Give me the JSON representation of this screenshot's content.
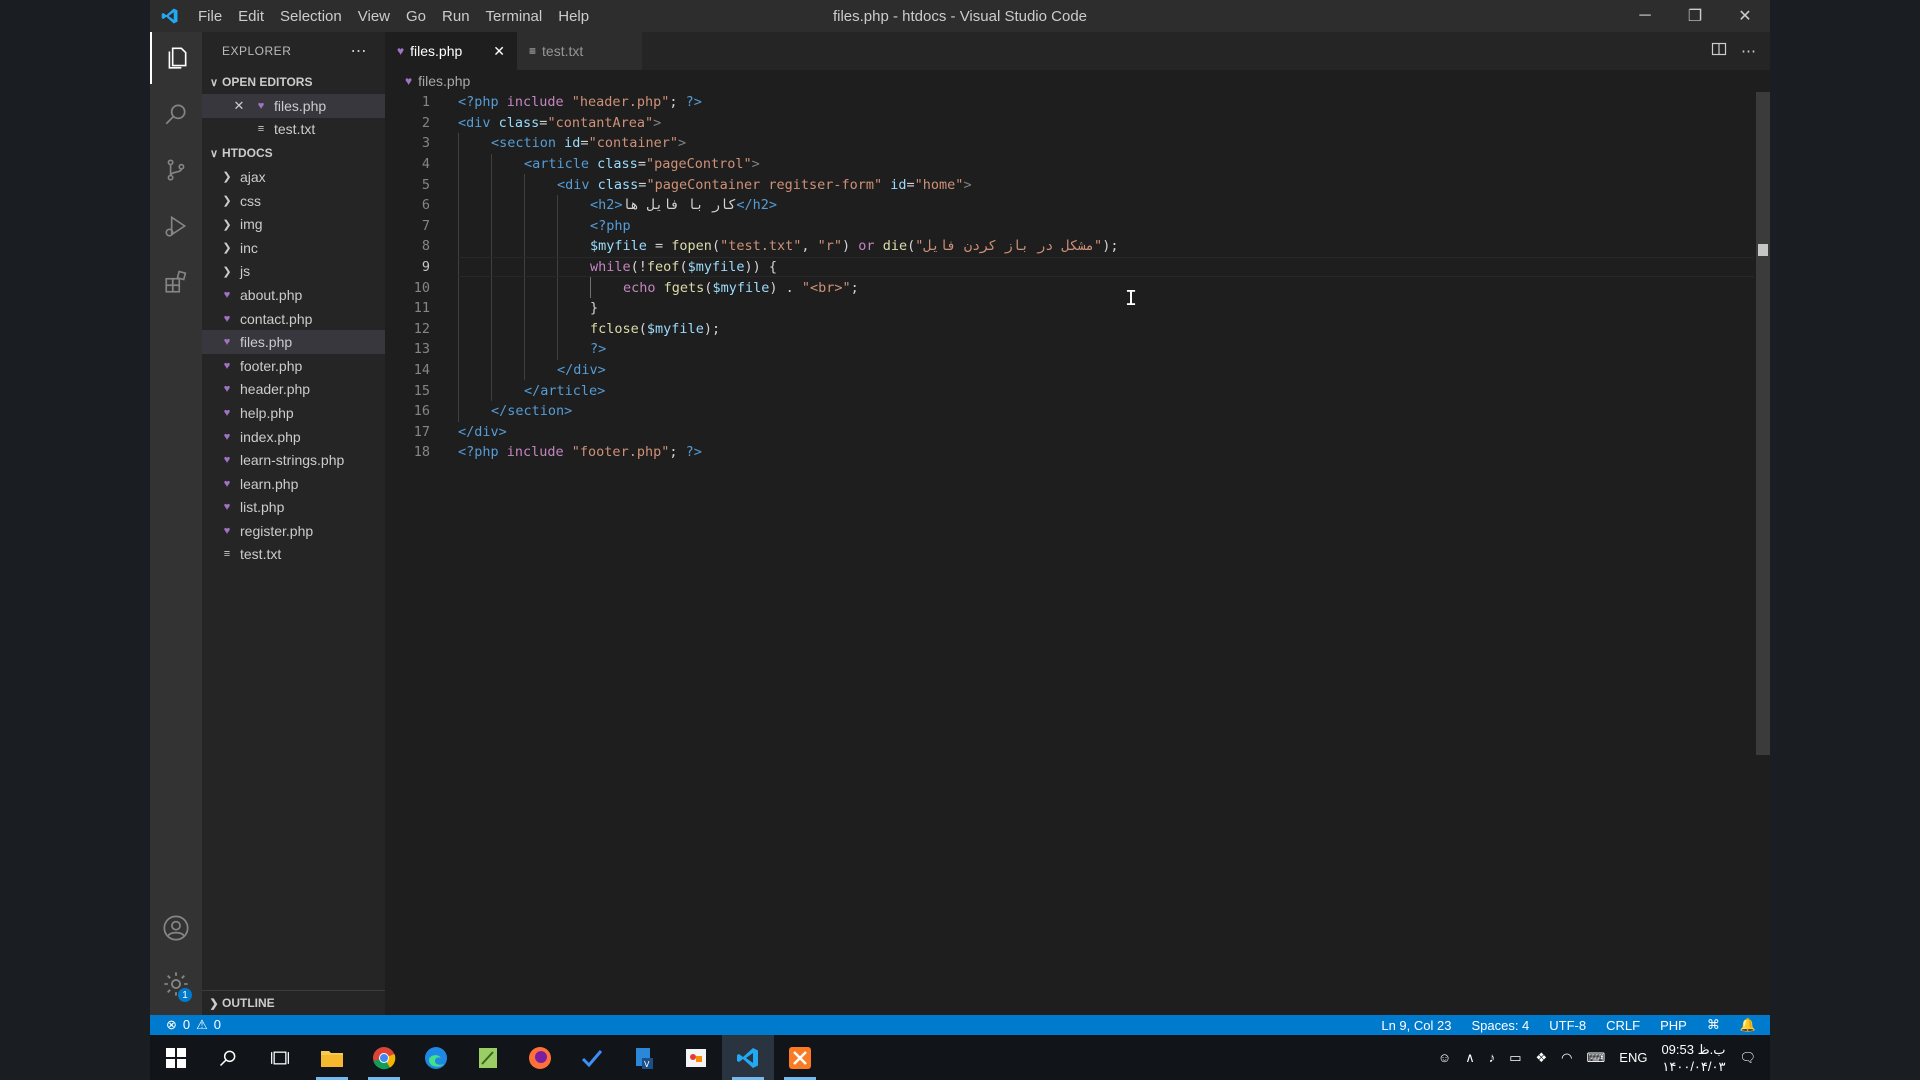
{
  "titlebar": {
    "menu": [
      "File",
      "Edit",
      "Selection",
      "View",
      "Go",
      "Run",
      "Terminal",
      "Help"
    ],
    "title": "files.php - htdocs - Visual Studio Code"
  },
  "sidebar": {
    "header": "EXPLORER",
    "open_editors_label": "OPEN EDITORS",
    "open_editors": [
      "files.php",
      "test.txt"
    ],
    "folder_label": "HTDOCS",
    "folders": [
      "ajax",
      "css",
      "img",
      "inc",
      "js"
    ],
    "files": [
      "about.php",
      "contact.php",
      "files.php",
      "footer.php",
      "header.php",
      "help.php",
      "index.php",
      "learn-strings.php",
      "learn.php",
      "list.php",
      "register.php",
      "test.txt"
    ],
    "outline_label": "OUTLINE"
  },
  "tabs": [
    "files.php",
    "test.txt"
  ],
  "breadcrumb": "files.php",
  "code": {
    "current_line": 9,
    "line_numbers": [
      "1",
      "2",
      "3",
      "4",
      "5",
      "6",
      "7",
      "8",
      "9",
      "10",
      "11",
      "12",
      "13",
      "14",
      "15",
      "16",
      "17",
      "18"
    ],
    "l1": [
      "<?php",
      " include ",
      "\"header.php\"",
      "; ",
      "?>"
    ],
    "l2": [
      "<div",
      " class",
      "=",
      "\"contantArea\"",
      ">"
    ],
    "l3": [
      "<section",
      " id",
      "=",
      "\"container\"",
      ">"
    ],
    "l4": [
      "<article",
      " class",
      "=",
      "\"pageControl\"",
      ">"
    ],
    "l5": [
      "<div",
      " class",
      "=",
      "\"pageContainer regitser-form\"",
      " id",
      "=",
      "\"home\"",
      ">"
    ],
    "l6": [
      "<h2>",
      "کار با فایل ها",
      "</h2>"
    ],
    "l7": [
      "<?php"
    ],
    "l8": [
      "$myfile",
      " = ",
      "fopen",
      "(",
      "\"test.txt\"",
      ", ",
      "\"r\"",
      ") ",
      "or",
      " ",
      "die",
      "(",
      "\"مشکل در باز کردن فایل\"",
      ");"
    ],
    "l9": [
      "while",
      "(",
      "!",
      "feof",
      "(",
      "$myfile",
      ")) {"
    ],
    "l10": [
      "echo",
      " ",
      "fgets",
      "(",
      "$myfile",
      ") . ",
      "\"<br>\"",
      ";"
    ],
    "l11": [
      "}"
    ],
    "l12": [
      "fclose",
      "(",
      "$myfile",
      ");"
    ],
    "l13": [
      "?>"
    ],
    "l14": [
      "</div>"
    ],
    "l15": [
      "</article>"
    ],
    "l16": [
      "</section>"
    ],
    "l17": [
      "</div>"
    ],
    "l18": [
      "<?php",
      " include ",
      "\"footer.php\"",
      "; ",
      "?>"
    ]
  },
  "statusbar": {
    "errors": "0",
    "warnings": "0",
    "position": "Ln 9, Col 23",
    "spaces": "Spaces: 4",
    "encoding": "UTF-8",
    "eol": "CRLF",
    "language": "PHP"
  },
  "taskbar": {
    "lang": "ENG",
    "time": "09:53 ب.ظ",
    "date": "۱۴۰۰/۰۴/۰۳"
  },
  "colors": {
    "accent": "#007acc",
    "php_icon": "#a074c4"
  }
}
